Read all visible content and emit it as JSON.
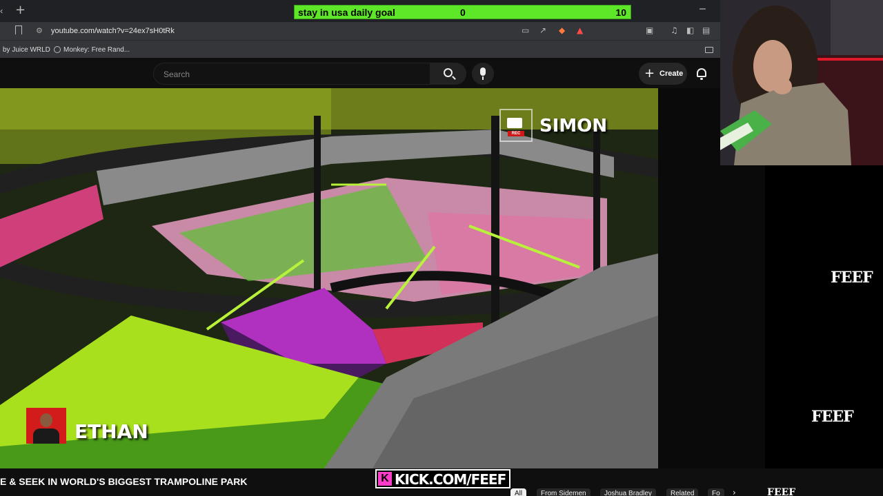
{
  "goal": {
    "text": "stay in usa daily goal",
    "current": "0",
    "target": "10",
    "progress": 0
  },
  "browser": {
    "tab_back": "‹",
    "tab_new": "+",
    "minimize": "–",
    "url": "youtube.com/watch?v=24ex7sH0tRk",
    "bookmarks": [
      "by Juice WRLD",
      "Monkey: Free Rand..."
    ]
  },
  "youtube": {
    "search_placeholder": "Search",
    "create_label": "Create",
    "create_plus": "+"
  },
  "video": {
    "overlay_name_top": "SIMON",
    "overlay_name_bottom": "ETHAN",
    "rec_label": "REC",
    "title": "E & SEEK IN WORLD'S BIGGEST TRAMPOLINE PARK"
  },
  "stream": {
    "kick_k": "K",
    "kick_url": "KICK.COM/FEEF",
    "logo_text": "FEEF"
  },
  "chips": [
    "All",
    "From Sidemen",
    "Joshua Bradley",
    "Related",
    "Fo"
  ],
  "chip_next": "›",
  "colors": {
    "goal_bar": "#5ee629",
    "kick_pink": "#ff3cc7",
    "ethan_red": "#d21c1c"
  }
}
